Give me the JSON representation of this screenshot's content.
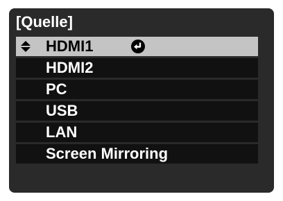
{
  "window": {
    "title": "[Quelle]"
  },
  "menu": {
    "items": [
      {
        "label": "HDMI1",
        "selected": true
      },
      {
        "label": "HDMI2",
        "selected": false
      },
      {
        "label": "PC",
        "selected": false
      },
      {
        "label": "USB",
        "selected": false
      },
      {
        "label": "LAN",
        "selected": false
      },
      {
        "label": "Screen Mirroring",
        "selected": false
      }
    ]
  },
  "icons": {
    "selection_indicator": "up-down-arrows-icon",
    "confirm": "enter-return-icon"
  },
  "colors": {
    "background": "#2a2a2a",
    "item_background": "#111111",
    "selected_background": "#c4c4c4",
    "text": "#ffffff",
    "selected_text": "#000000"
  }
}
